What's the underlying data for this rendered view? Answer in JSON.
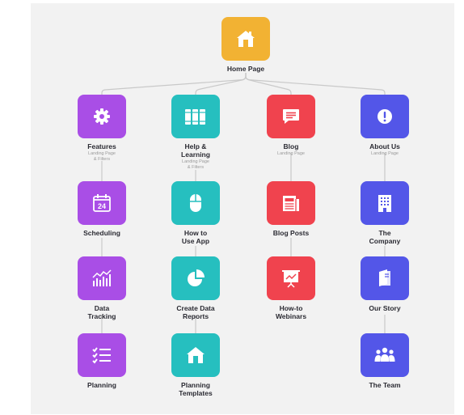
{
  "colors": {
    "background": "#f2f2f2",
    "connector": "#c9c9c9",
    "home": "#f2b233",
    "features": "#a94ee6",
    "help": "#26bfbf",
    "blog": "#f0434e",
    "about": "#5356e8"
  },
  "home": {
    "label": "Home Page",
    "icon": "home-icon"
  },
  "features": {
    "label": "Features",
    "sub": "Landing Page\n& Filters",
    "icon": "gear-icon",
    "children": [
      {
        "label": "Scheduling",
        "icon": "calendar-icon",
        "calendar_day": "24"
      },
      {
        "label": "Data\nTracking",
        "icon": "bar-chart-icon"
      },
      {
        "label": "Planning",
        "icon": "checklist-icon"
      }
    ]
  },
  "help": {
    "label": "Help &\nLearning",
    "sub": "Landing Page\n& Filters",
    "icon": "books-icon",
    "children": [
      {
        "label": "How to\nUse App",
        "icon": "mouse-icon"
      },
      {
        "label": "Create Data\nReports",
        "icon": "pie-chart-icon"
      },
      {
        "label": "Planning\nTemplates",
        "icon": "house-icon"
      }
    ]
  },
  "blog": {
    "label": "Blog",
    "sub": "Landing Page",
    "icon": "chat-icon",
    "children": [
      {
        "label": "Blog Posts",
        "icon": "newspaper-icon"
      },
      {
        "label": "How-to\nWebinars",
        "icon": "presentation-icon"
      }
    ]
  },
  "about": {
    "label": "About Us",
    "sub": "Landing Page",
    "icon": "info-icon",
    "children": [
      {
        "label": "The\nCompany",
        "icon": "building-icon"
      },
      {
        "label": "Our Story",
        "icon": "book-icon"
      },
      {
        "label": "The Team",
        "icon": "team-icon"
      }
    ]
  }
}
